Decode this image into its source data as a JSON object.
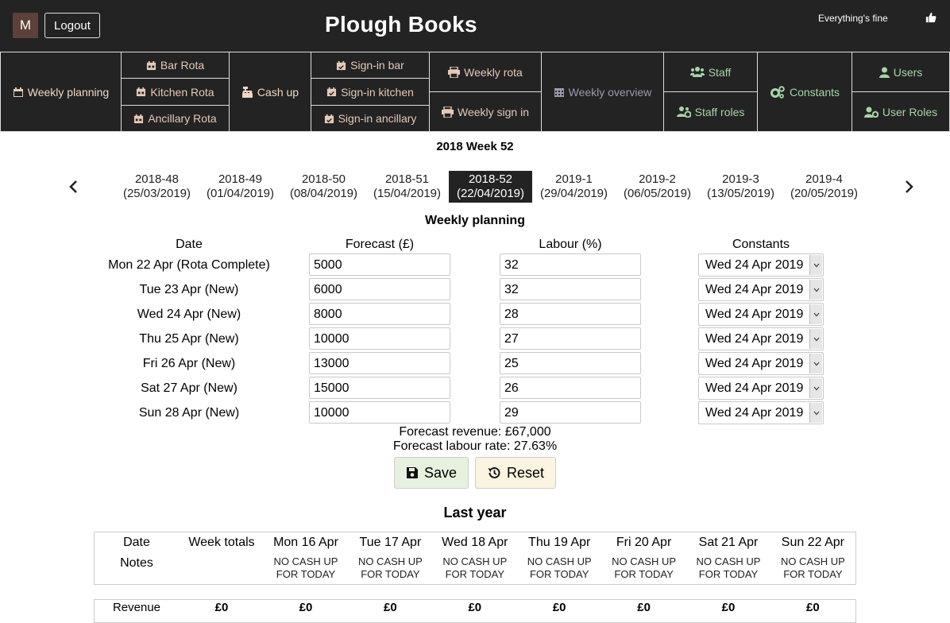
{
  "header": {
    "avatar_letter": "M",
    "logout_label": "Logout",
    "app_title": "Plough Books",
    "status_text": "Everything's fine"
  },
  "nav": {
    "weekly_planning": "Weekly planning",
    "bar_rota": "Bar Rota",
    "kitchen_rota": "Kitchen Rota",
    "ancillary_rota": "Ancillary Rota",
    "cash_up": "Cash up",
    "signin_bar": "Sign-in bar",
    "signin_kitchen": "Sign-in kitchen",
    "signin_ancillary": "Sign-in ancillary",
    "weekly_rota": "Weekly rota",
    "weekly_signin": "Weekly sign in",
    "weekly_overview": "Weekly overview",
    "staff": "Staff",
    "staff_roles": "Staff roles",
    "constants": "Constants",
    "users": "Users",
    "user_roles": "User Roles"
  },
  "week_title": "2018 Week 52",
  "weeks": [
    {
      "week": "2018-48",
      "date": "(25/03/2019)"
    },
    {
      "week": "2018-49",
      "date": "(01/04/2019)"
    },
    {
      "week": "2018-50",
      "date": "(08/04/2019)"
    },
    {
      "week": "2018-51",
      "date": "(15/04/2019)"
    },
    {
      "week": "2018-52",
      "date": "(22/04/2019)"
    },
    {
      "week": "2019-1",
      "date": "(29/04/2019)"
    },
    {
      "week": "2019-2",
      "date": "(06/05/2019)"
    },
    {
      "week": "2019-3",
      "date": "(13/05/2019)"
    },
    {
      "week": "2019-4",
      "date": "(20/05/2019)"
    }
  ],
  "planning": {
    "title": "Weekly planning",
    "headers": {
      "date": "Date",
      "forecast": "Forecast (£)",
      "labour": "Labour (%)",
      "constants": "Constants"
    },
    "rows": [
      {
        "date": "Mon 22 Apr (Rota Complete)",
        "forecast": "5000",
        "labour": "32",
        "constants": "Wed 24 Apr 2019"
      },
      {
        "date": "Tue 23 Apr (New)",
        "forecast": "6000",
        "labour": "32",
        "constants": "Wed 24 Apr 2019"
      },
      {
        "date": "Wed 24 Apr (New)",
        "forecast": "8000",
        "labour": "28",
        "constants": "Wed 24 Apr 2019"
      },
      {
        "date": "Thu 25 Apr (New)",
        "forecast": "10000",
        "labour": "27",
        "constants": "Wed 24 Apr 2019"
      },
      {
        "date": "Fri 26 Apr (New)",
        "forecast": "13000",
        "labour": "25",
        "constants": "Wed 24 Apr 2019"
      },
      {
        "date": "Sat 27 Apr (New)",
        "forecast": "15000",
        "labour": "26",
        "constants": "Wed 24 Apr 2019"
      },
      {
        "date": "Sun 28 Apr (New)",
        "forecast": "10000",
        "labour": "29",
        "constants": "Wed 24 Apr 2019"
      }
    ],
    "forecast_revenue": "Forecast revenue: £67,000",
    "forecast_labour": "Forecast labour rate: 27.63%",
    "save_label": "Save",
    "reset_label": "Reset"
  },
  "last_year": {
    "title": "Last year",
    "date_label": "Date",
    "notes_label": "Notes",
    "totals_label": "Week totals",
    "revenue_label": "Revenue",
    "days": [
      {
        "day": "Mon 16 Apr",
        "note": "NO CASH UP FOR TODAY",
        "revenue": "£0"
      },
      {
        "day": "Tue 17 Apr",
        "note": "NO CASH UP FOR TODAY",
        "revenue": "£0"
      },
      {
        "day": "Wed 18 Apr",
        "note": "NO CASH UP FOR TODAY",
        "revenue": "£0"
      },
      {
        "day": "Thu 19 Apr",
        "note": "NO CASH UP FOR TODAY",
        "revenue": "£0"
      },
      {
        "day": "Fri 20 Apr",
        "note": "NO CASH UP FOR TODAY",
        "revenue": "£0"
      },
      {
        "day": "Sat 21 Apr",
        "note": "NO CASH UP FOR TODAY",
        "revenue": "£0"
      },
      {
        "day": "Sun 22 Apr",
        "note": "NO CASH UP FOR TODAY",
        "revenue": "£0"
      }
    ],
    "total_revenue": "£0"
  },
  "colors": {
    "dark": "#232323",
    "accent_text": "#e6c9b8",
    "save_bg": "#e6f2df",
    "reset_bg": "#fbf4e1"
  },
  "icons": [
    "thumbs-up-icon",
    "calendar-icon",
    "calendar-check-icon",
    "cash-register-icon",
    "print-icon",
    "users-icon",
    "users-cog-icon",
    "cogs-icon",
    "user-icon",
    "user-cog-icon",
    "save-icon",
    "history-icon",
    "chevron-left-icon",
    "chevron-right-icon"
  ]
}
